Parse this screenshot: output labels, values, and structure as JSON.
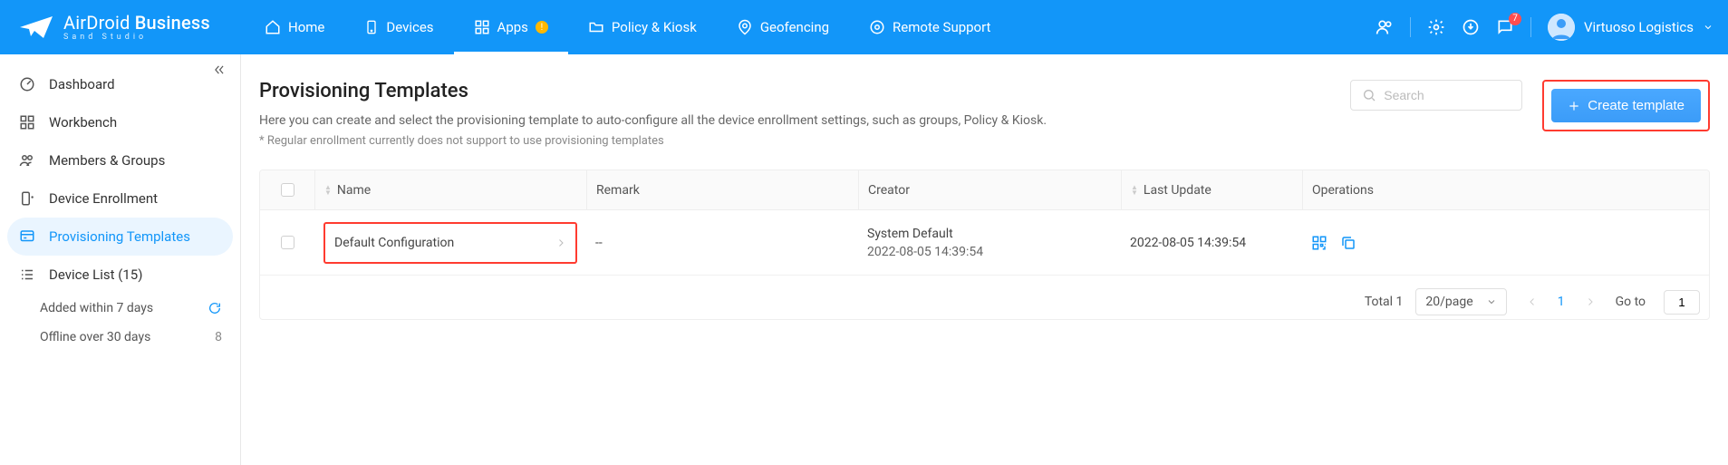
{
  "brand": {
    "name_a": "AirDroid",
    "name_b": "Business",
    "sub": "Sand Studio"
  },
  "nav": {
    "home": "Home",
    "devices": "Devices",
    "apps": "Apps",
    "policy": "Policy & Kiosk",
    "geo": "Geofencing",
    "remote": "Remote Support"
  },
  "notifications_count": "7",
  "user": {
    "name": "Virtuoso Logistics"
  },
  "sidebar": {
    "dashboard": "Dashboard",
    "workbench": "Workbench",
    "members": "Members & Groups",
    "enroll": "Device Enrollment",
    "provisioning": "Provisioning Templates",
    "device_list": "Device List (15)",
    "sub_added": "Added within 7 days",
    "sub_offline": "Offline over 30 days",
    "offline_count": "8"
  },
  "page": {
    "title": "Provisioning Templates",
    "desc": "Here you can create and select the provisioning template to auto-configure all the device enrollment settings, such as groups, Policy & Kiosk.",
    "note": "* Regular enrollment currently does not support to use provisioning templates",
    "search_placeholder": "Search",
    "create_btn": "Create template"
  },
  "table": {
    "headers": {
      "name": "Name",
      "remark": "Remark",
      "creator": "Creator",
      "last_update": "Last Update",
      "ops": "Operations"
    },
    "rows": [
      {
        "name": "Default Configuration",
        "remark": "--",
        "creator": "System Default",
        "creator_time": "2022-08-05 14:39:54",
        "last_update": "2022-08-05 14:39:54"
      }
    ]
  },
  "pagination": {
    "total_label": "Total 1",
    "per_page": "20/page",
    "current": "1",
    "goto_label": "Go to",
    "goto_value": "1"
  }
}
